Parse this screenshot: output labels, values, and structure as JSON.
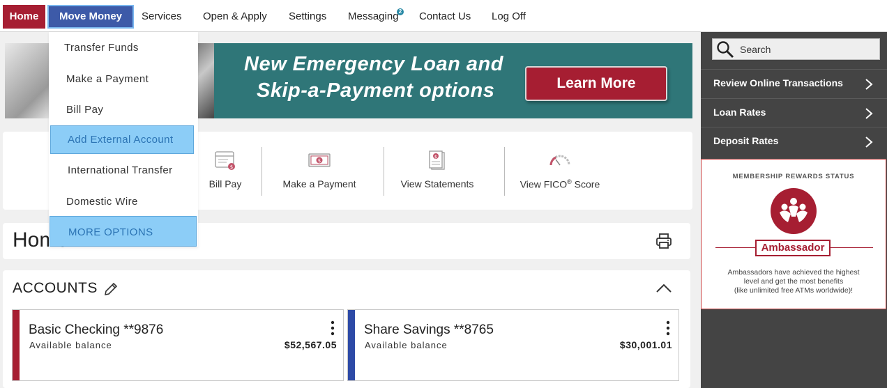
{
  "nav": {
    "home": "Home",
    "move_money": "Move Money",
    "services": "Services",
    "open_apply": "Open & Apply",
    "settings": "Settings",
    "messaging": "Messaging",
    "messaging_badge": "2",
    "contact": "Contact Us",
    "logoff": "Log Off"
  },
  "dropdown": {
    "items": [
      "Transfer Funds",
      "Make a Payment",
      "Bill Pay",
      "Add External Account",
      "International Transfer",
      "Domestic Wire",
      "MORE OPTIONS"
    ]
  },
  "banner": {
    "line1": "New Emergency Loan and",
    "line2": "Skip-a-Payment options",
    "cta": "Learn More"
  },
  "quick_actions": {
    "bill_pay": "Bill Pay",
    "make_payment": "Make a Payment",
    "view_statements": "View Statements",
    "fico_prefix": "View FICO",
    "fico_reg": "®",
    "fico_suffix": " Score"
  },
  "home": {
    "title": "Home"
  },
  "accounts": {
    "title": "ACCOUNTS",
    "items": [
      {
        "name": "Basic Checking **9876",
        "sub": "Available balance",
        "amount": "$52,567.05",
        "color": "#a61e32"
      },
      {
        "name": "Share Savings **8765",
        "sub": "Available balance",
        "amount": "$30,001.01",
        "color": "#2d4aa6"
      }
    ]
  },
  "sidebar": {
    "search_label": "Search",
    "links": [
      "Review Online Transactions",
      "Loan Rates",
      "Deposit Rates"
    ],
    "rewards": {
      "title": "MEMBERSHIP REWARDS STATUS",
      "badge": "Ambassador",
      "desc1": "Ambassadors have achieved the highest",
      "desc2": "level and get the most benefits",
      "desc3": "(like unlimited free ATMs worldwide)!"
    }
  },
  "colors": {
    "brand_red": "#a61e32",
    "brand_blue": "#3d5aa8",
    "teal": "#2f7678",
    "sidebar": "#444444",
    "highlight": "#8ccdf7"
  }
}
